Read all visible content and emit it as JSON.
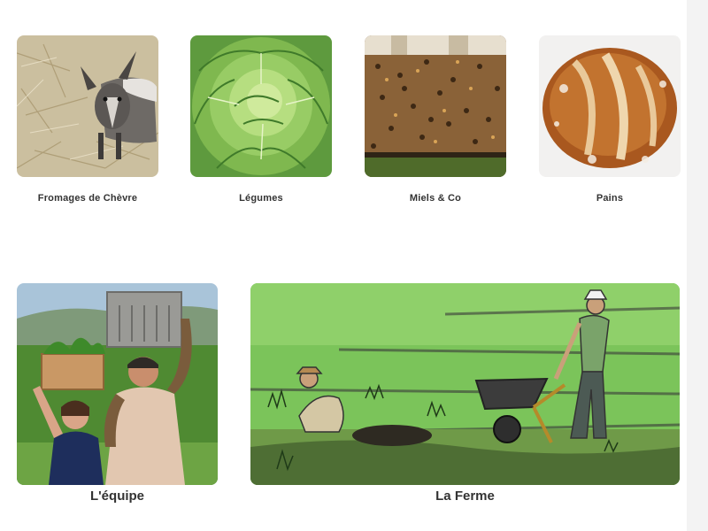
{
  "products": [
    {
      "label": "Fromages de Chèvre",
      "image": "goat-photo"
    },
    {
      "label": "Légumes",
      "image": "lettuce-illustration"
    },
    {
      "label": "Miels & Co",
      "image": "beehive-photo"
    },
    {
      "label": "Pains",
      "image": "bread-photo"
    }
  ],
  "sections": [
    {
      "label": "L'équipe",
      "image": "team-photo"
    },
    {
      "label": "La Ferme",
      "image": "farm-illustration"
    }
  ]
}
